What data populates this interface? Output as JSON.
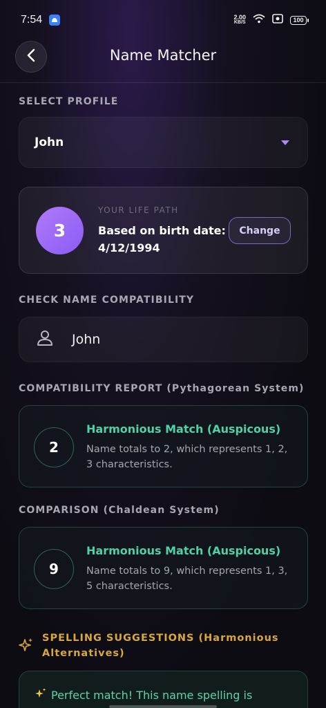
{
  "status": {
    "time": "7:54",
    "net_speed_value": "2.00",
    "net_speed_unit": "KB/S",
    "battery": "100"
  },
  "header": {
    "title": "Name Matcher"
  },
  "profile": {
    "section_label": "SELECT PROFILE",
    "selected": "John"
  },
  "life_path": {
    "number": "3",
    "label": "YOUR LIFE PATH",
    "text_line1": "Based on birth date:",
    "text_line2": "4/12/1994",
    "change_label": "Change"
  },
  "name_check": {
    "section_label": "CHECK NAME COMPATIBILITY",
    "value": "John"
  },
  "pythagorean": {
    "section_label": "COMPATIBILITY REPORT (Pythagorean System)",
    "number": "2",
    "title": "Harmonious Match (Auspicous)",
    "description": "Name totals to 2, which represents 1, 2, 3 characteristics."
  },
  "chaldean": {
    "section_label": "COMPARISON (Chaldean System)",
    "number": "9",
    "title": "Harmonious Match (Auspicous)",
    "description": "Name totals to 9, which represents 1, 3, 5 characteristics."
  },
  "spelling": {
    "section_label": "SPELLING SUGGESTIONS (Harmonious Alternatives)",
    "message": "Perfect match! This name spelling is"
  },
  "colors": {
    "accent_purple": "#8b5cf6",
    "match_green": "#4fd1a5",
    "suggestion_gold": "#d9a83a"
  },
  "icons": [
    "back-arrow-icon",
    "caret-down-icon",
    "person-icon",
    "sparkles-icon",
    "wifi-icon",
    "battery-icon"
  ]
}
